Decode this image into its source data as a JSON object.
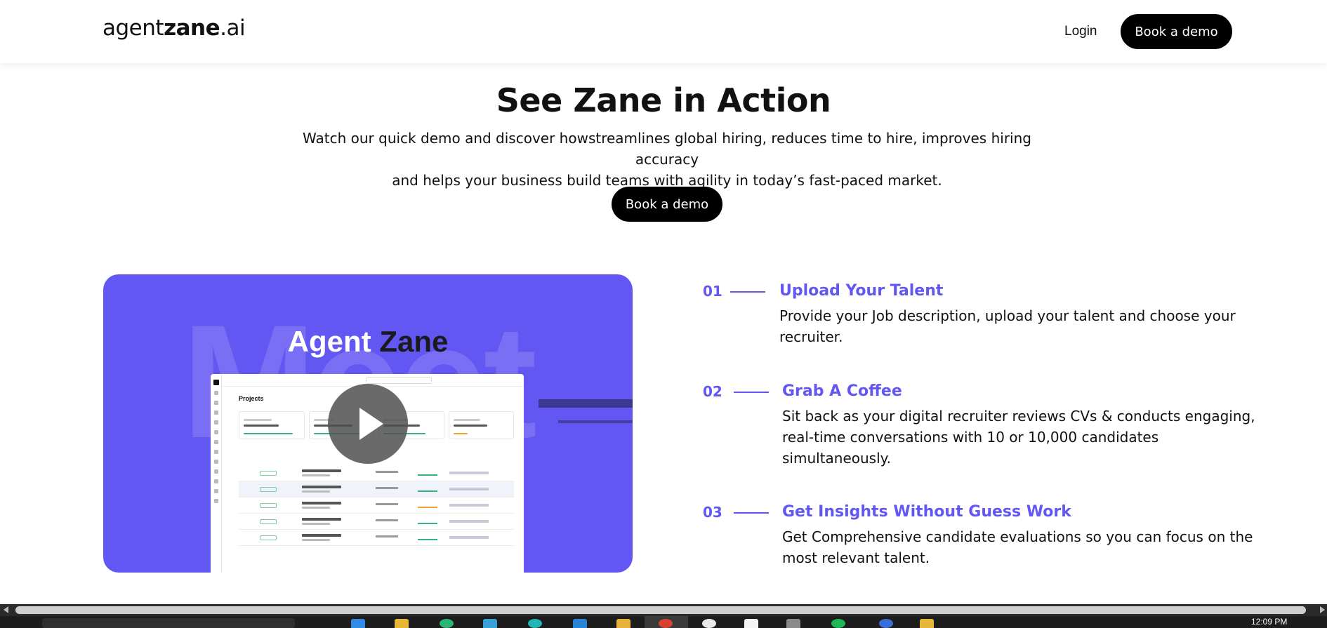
{
  "header": {
    "logo_prefix": "agent",
    "logo_bold": "zane",
    "logo_suffix": ".ai",
    "login_label": "Login",
    "book_demo_label": "Book a demo"
  },
  "hero": {
    "title": "See Zane in Action",
    "subtitle_line1": "Watch our quick demo and discover howstreamlines global hiring, reduces time to hire, improves hiring accuracy",
    "subtitle_line2": "and helps your business build teams with agility in today’s fast-paced market.",
    "book_demo_label": "Book a demo"
  },
  "video": {
    "background_word": "Meet",
    "heading_light": "Agent",
    "heading_dark": "Zane",
    "app_title": "Projects",
    "accent_color": "#6357f3"
  },
  "steps": [
    {
      "number": "01",
      "title": "Upload Your Talent",
      "description_line1": "Provide your Job description, upload your talent and choose your",
      "description_line2": "recruiter."
    },
    {
      "number": "02",
      "title": "Grab A Coffee",
      "description_line1": "Sit back as your digital recruiter reviews CVs & conducts engaging,",
      "description_line2": "real-time conversations with 10 or 10,000 candidates",
      "description_line3": "simultaneously."
    },
    {
      "number": "03",
      "title": "Get Insights Without Guess Work",
      "description_line1": "Get Comprehensive candidate evaluations so you can focus on the",
      "description_line2": "most relevant talent."
    }
  ],
  "taskbar": {
    "clock": "12:09 PM"
  }
}
